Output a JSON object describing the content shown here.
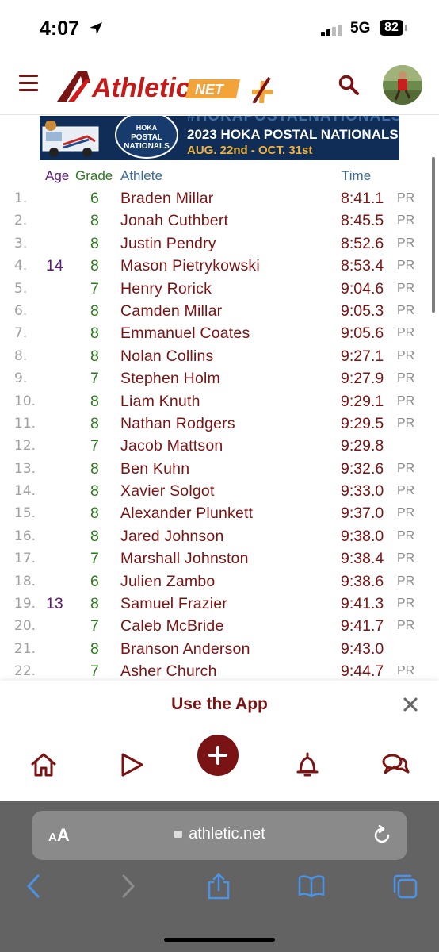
{
  "status_bar": {
    "time": "4:07",
    "network": "5G",
    "battery": "82"
  },
  "header": {
    "logo_text": "Athletic",
    "logo_net": "NET"
  },
  "banner": {
    "hashtag": "#HOKAPOSTALNATIONALS",
    "title": "2023 HOKA POSTAL NATIONALS",
    "dates": "AUG. 22nd - OCT. 31st",
    "badge_top": "HOKA",
    "badge_main": "POSTAL NATIONALS"
  },
  "columns": {
    "age": "Age",
    "grade": "Grade",
    "athlete": "Athlete",
    "time": "Time"
  },
  "results": [
    {
      "place": "1.",
      "age": "",
      "grade": "6",
      "name": "Braden Millar",
      "time": "8:41.1",
      "pr": "PR"
    },
    {
      "place": "2.",
      "age": "",
      "grade": "8",
      "name": "Jonah Cuthbert",
      "time": "8:45.5",
      "pr": "PR"
    },
    {
      "place": "3.",
      "age": "",
      "grade": "8",
      "name": "Justin Pendry",
      "time": "8:52.6",
      "pr": "PR"
    },
    {
      "place": "4.",
      "age": "14",
      "grade": "8",
      "name": "Mason Pietrykowski",
      "time": "8:53.4",
      "pr": "PR"
    },
    {
      "place": "5.",
      "age": "",
      "grade": "7",
      "name": "Henry Rorick",
      "time": "9:04.6",
      "pr": "PR"
    },
    {
      "place": "6.",
      "age": "",
      "grade": "8",
      "name": "Camden Millar",
      "time": "9:05.3",
      "pr": "PR"
    },
    {
      "place": "7.",
      "age": "",
      "grade": "8",
      "name": "Emmanuel Coates",
      "time": "9:05.6",
      "pr": "PR"
    },
    {
      "place": "8.",
      "age": "",
      "grade": "8",
      "name": "Nolan Collins",
      "time": "9:27.1",
      "pr": "PR"
    },
    {
      "place": "9.",
      "age": "",
      "grade": "7",
      "name": "Stephen Holm",
      "time": "9:27.9",
      "pr": "PR"
    },
    {
      "place": "10.",
      "age": "",
      "grade": "8",
      "name": "Liam Knuth",
      "time": "9:29.1",
      "pr": "PR"
    },
    {
      "place": "11.",
      "age": "",
      "grade": "8",
      "name": "Nathan Rodgers",
      "time": "9:29.5",
      "pr": "PR"
    },
    {
      "place": "12.",
      "age": "",
      "grade": "7",
      "name": "Jacob Mattson",
      "time": "9:29.8",
      "pr": ""
    },
    {
      "place": "13.",
      "age": "",
      "grade": "8",
      "name": "Ben Kuhn",
      "time": "9:32.6",
      "pr": "PR"
    },
    {
      "place": "14.",
      "age": "",
      "grade": "8",
      "name": "Xavier Solgot",
      "time": "9:33.0",
      "pr": "PR"
    },
    {
      "place": "15.",
      "age": "",
      "grade": "8",
      "name": "Alexander Plunkett",
      "time": "9:37.0",
      "pr": "PR"
    },
    {
      "place": "16.",
      "age": "",
      "grade": "8",
      "name": "Jared Johnson",
      "time": "9:38.0",
      "pr": "PR"
    },
    {
      "place": "17.",
      "age": "",
      "grade": "7",
      "name": "Marshall Johnston",
      "time": "9:38.4",
      "pr": "PR"
    },
    {
      "place": "18.",
      "age": "",
      "grade": "6",
      "name": "Julien Zambo",
      "time": "9:38.6",
      "pr": "PR"
    },
    {
      "place": "19.",
      "age": "13",
      "grade": "8",
      "name": "Samuel Frazier",
      "time": "9:41.3",
      "pr": "PR"
    },
    {
      "place": "20.",
      "age": "",
      "grade": "7",
      "name": "Caleb McBride",
      "time": "9:41.7",
      "pr": "PR"
    },
    {
      "place": "21.",
      "age": "",
      "grade": "8",
      "name": "Branson Anderson",
      "time": "9:43.0",
      "pr": ""
    },
    {
      "place": "22.",
      "age": "",
      "grade": "7",
      "name": "Asher Church",
      "time": "9:44.7",
      "pr": "PR"
    }
  ],
  "app_prompt": {
    "label": "Use the App"
  },
  "browser": {
    "aa_small": "A",
    "aa_large": "A",
    "url": "athletic.net"
  },
  "colors": {
    "brand": "#7a1313",
    "grade": "#2c7a1f",
    "age": "#5b1a7a",
    "header_col": "#3b6a94"
  }
}
